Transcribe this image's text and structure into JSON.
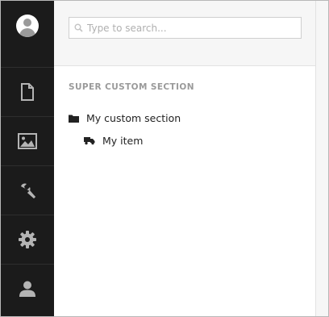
{
  "sidebar": {
    "items": [
      {
        "name": "avatar",
        "icon": "user-avatar-icon"
      },
      {
        "name": "content",
        "icon": "document-icon"
      },
      {
        "name": "media",
        "icon": "image-icon"
      },
      {
        "name": "tools",
        "icon": "wrench-icon"
      },
      {
        "name": "settings",
        "icon": "gear-icon"
      },
      {
        "name": "members",
        "icon": "person-icon"
      }
    ],
    "background": "#1b1b1b",
    "icon_color": "#b4b4b4"
  },
  "search": {
    "placeholder": "Type to search...",
    "value": ""
  },
  "section": {
    "title": "SUPER CUSTOM SECTION",
    "tree": [
      {
        "label": "My custom section",
        "icon": "folder-icon",
        "children": [
          {
            "label": "My item",
            "icon": "truck-icon"
          }
        ]
      }
    ]
  }
}
